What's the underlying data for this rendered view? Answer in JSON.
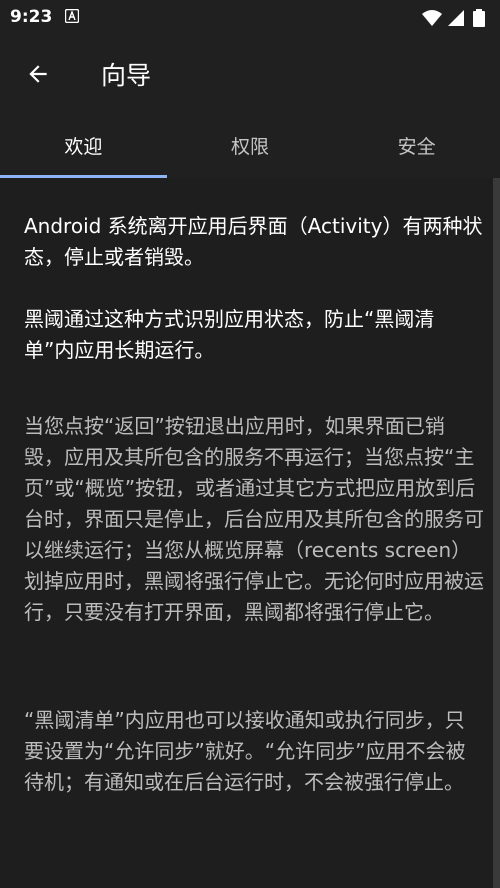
{
  "status_bar": {
    "time": "9:23",
    "notification_icon": "a-box-icon",
    "icons": [
      "wifi-icon",
      "signal-icon",
      "battery-icon"
    ]
  },
  "app_bar": {
    "back_icon": "arrow-left-icon",
    "title": "向导"
  },
  "tabs": [
    {
      "label": "欢迎",
      "selected": true
    },
    {
      "label": "权限",
      "selected": false
    },
    {
      "label": "安全",
      "selected": false
    }
  ],
  "content": {
    "paragraphs": [
      "Android 系统离开应用后界面（Activity）有两种状态，停止或者销毁。",
      "黑阈通过这种方式识别应用状态，防止“黑阈清单”内应用长期运行。",
      "当您点按“返回”按钮退出应用时，如果界面已销毁，应用及其所包含的服务不再运行；当您点按“主页”或“概览”按钮，或者通过其它方式把应用放到后台时，界面只是停止，后台应用及其所包含的服务可以继续运行；当您从概览屏幕（recents screen）划掉应用时，黑阈将强行停止它。无论何时应用被运行，只要没有打开界面，黑阈都将强行停止它。",
      "“黑阈清单”内应用也可以接收通知或执行同步，只要设置为“允许同步”就好。“允许同步”应用不会被待机；有通知或在后台运行时，不会被强行停止。"
    ]
  },
  "colors": {
    "background": "#1e1e1e",
    "tab_indicator": "#8fb4f5",
    "secondary_text": "#bcbcbc"
  }
}
